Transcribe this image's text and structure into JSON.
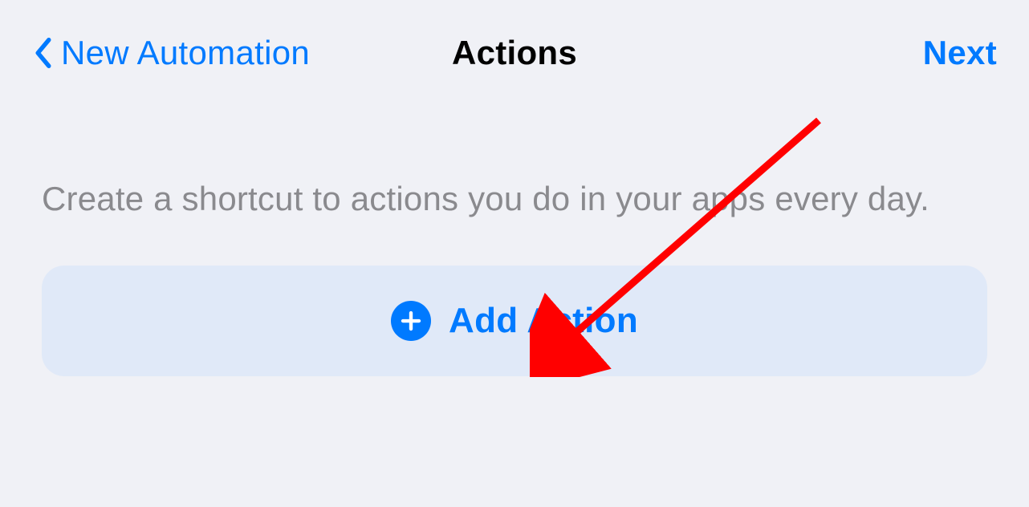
{
  "navbar": {
    "back_label": "New Automation",
    "title": "Actions",
    "next_label": "Next"
  },
  "content": {
    "description": "Create a shortcut to actions you do in your apps every day.",
    "add_action_label": "Add Action"
  },
  "colors": {
    "accent": "#007aff",
    "background": "#f0f1f6",
    "button_bg": "#e0e9f8",
    "text_secondary": "#8a8a8e"
  }
}
